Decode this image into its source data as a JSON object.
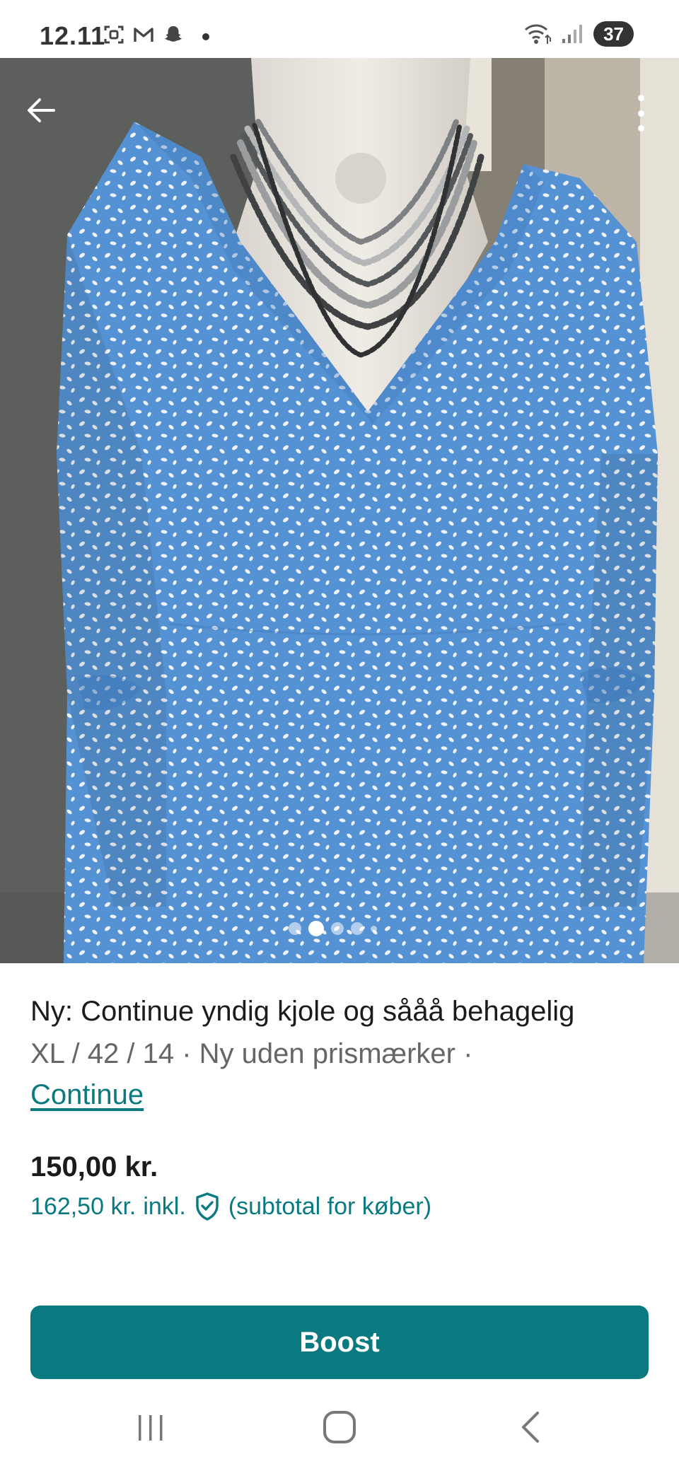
{
  "status_bar": {
    "time": "12.11",
    "battery": "37",
    "icons": [
      "screenshot-icon",
      "gmail-icon",
      "snapchat-icon",
      "wifi-icon",
      "signal-icon"
    ]
  },
  "listing": {
    "photo_count": 5,
    "active_photo": 2,
    "title": "Ny: Continue yndig kjole og sååå behagelig",
    "subtitle": "XL / 42 / 14 · Ny uden prismærker ·",
    "brand": "Continue",
    "price": "150,00 kr.",
    "total_price": "162,50 kr.",
    "total_incl": "inkl.",
    "total_note": "(subtotal for køber)"
  },
  "actions": {
    "boost_label": "Boost"
  },
  "colors": {
    "accent": "#0b7a80",
    "photo_dress": "#5592d3"
  }
}
